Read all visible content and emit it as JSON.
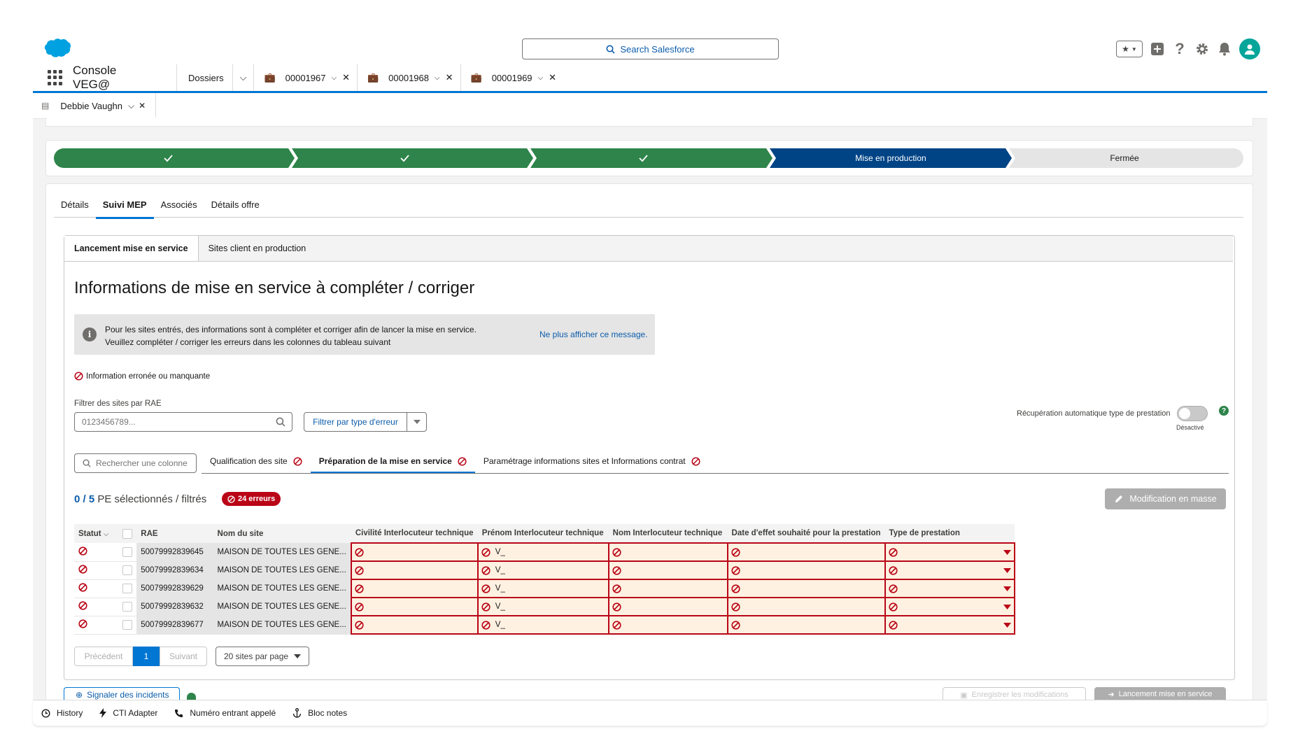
{
  "colors": {
    "brand": "#0176d3",
    "success": "#2e844a",
    "error": "#ba0517",
    "path_current": "#014486"
  },
  "header": {
    "search_placeholder": "Search Salesforce"
  },
  "nav": {
    "app_name": "Console VEG@",
    "object_tab": "Dossiers",
    "tabs": [
      {
        "label": "00001967"
      },
      {
        "label": "00001968"
      },
      {
        "label": "00001969"
      }
    ]
  },
  "subtab": {
    "label": "Debbie Vaughn"
  },
  "path": {
    "steps": [
      {
        "label": "",
        "status": "complete"
      },
      {
        "label": "",
        "status": "complete"
      },
      {
        "label": "",
        "status": "complete"
      },
      {
        "label": "Mise en production",
        "status": "current"
      },
      {
        "label": "Fermée",
        "status": "incomplete"
      }
    ]
  },
  "record_tabs": [
    "Détails",
    "Suivi MEP",
    "Associés",
    "Détails offre"
  ],
  "inner_tabs": [
    "Lancement mise en service",
    "Sites client en production"
  ],
  "main": {
    "title": "Informations de mise en service à compléter / corriger",
    "info_line1": "Pour les sites entrés, des informations sont à compléter et corriger afin de lancer la mise en service.",
    "info_line2": "Veuillez compléter / corriger les erreurs dans les colonnes du tableau suivant",
    "info_link": "Ne plus afficher ce message.",
    "legend": "Information erronée ou manquante",
    "filter_label": "Filtrer des sites par RAE",
    "filter_placeholder": "0123456789...",
    "error_filter_label": "Filtrer par type d'erreur",
    "toggle_label": "Récupération automatique type de prestation",
    "toggle_state": "Désactivé",
    "column_search": "Rechercher une colonne",
    "section_tabs": [
      "Qualification des site",
      "Préparation de la mise en service",
      "Paramétrage informations sites et Informations contrat"
    ],
    "selected": "0 / 5",
    "selected_suffix": "PE sélectionnés / filtrés",
    "errors_badge": "24 erreurs",
    "mass_edit": "Modification en masse"
  },
  "table": {
    "headers": [
      "Statut",
      "RAE",
      "Nom du site",
      "Civilité Interlocuteur technique",
      "Prénom Interlocuteur technique",
      "Nom Interlocuteur technique",
      "Date d'effet souhaité pour la prestation",
      "Type de prestation"
    ],
    "rows": [
      {
        "rae": "50079992839645",
        "name": "MAISON DE TOUTES LES GENE...",
        "prenom": "V_"
      },
      {
        "rae": "50079992839634",
        "name": "MAISON DE TOUTES LES GENE...",
        "prenom": "V_"
      },
      {
        "rae": "50079992839629",
        "name": "MAISON DE TOUTES LES GENE...",
        "prenom": "V_"
      },
      {
        "rae": "50079992839632",
        "name": "MAISON DE TOUTES LES GENE...",
        "prenom": "V_"
      },
      {
        "rae": "50079992839677",
        "name": "MAISON DE TOUTES LES GENE...",
        "prenom": "V_"
      }
    ]
  },
  "pagination": {
    "prev": "Précédent",
    "page": "1",
    "next": "Suivant",
    "per_page": "20 sites par page"
  },
  "footer_actions": {
    "report": "Signaler des incidents",
    "save": "Enregistrer les modifications",
    "launch": "Lancement mise en service"
  },
  "utility_bar": [
    "History",
    "CTI Adapter",
    "Numéro entrant appelé",
    "Bloc notes"
  ]
}
